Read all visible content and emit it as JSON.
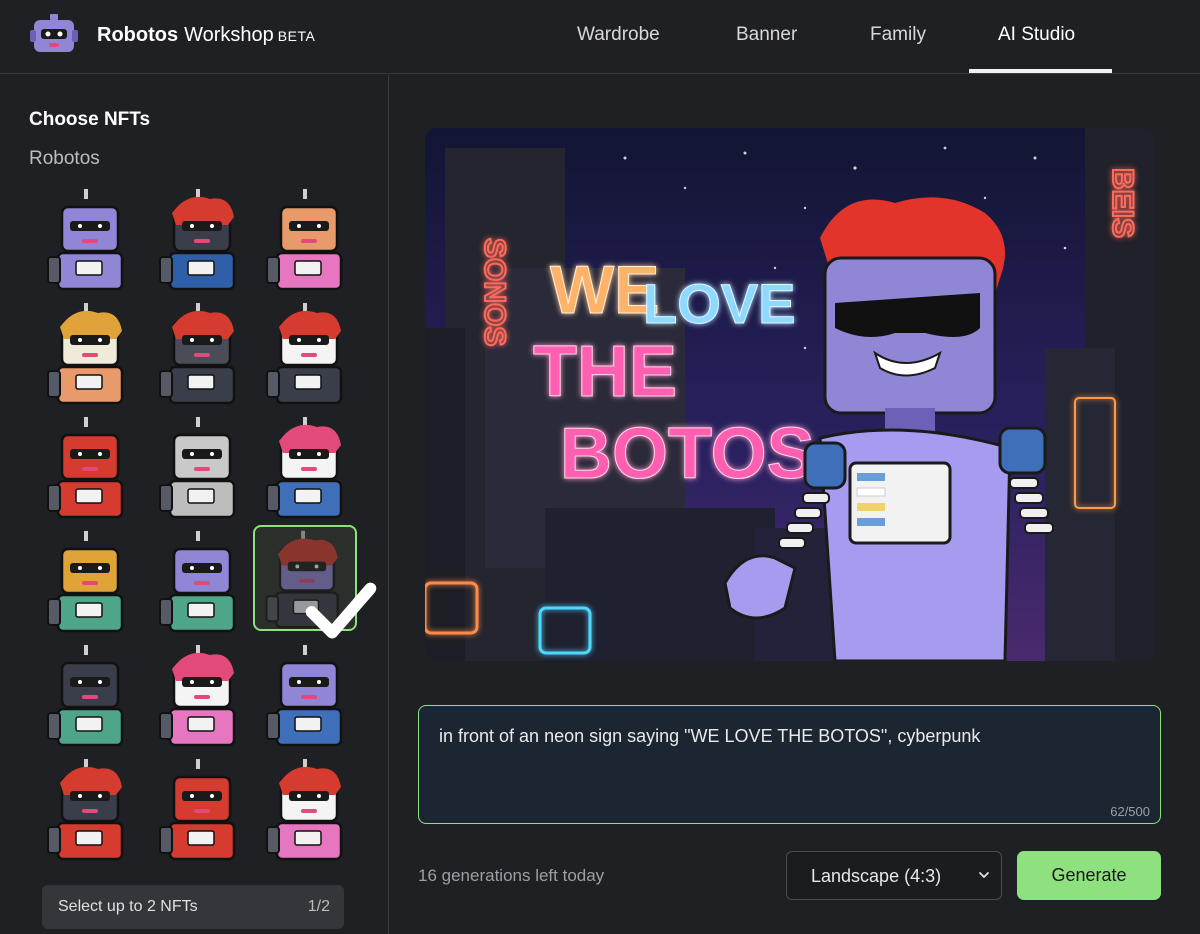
{
  "header": {
    "brand_name": "Robotos",
    "brand_product": "Workshop",
    "brand_tag": "BETA",
    "tabs": [
      {
        "label": "Wardrobe",
        "active": false
      },
      {
        "label": "Banner",
        "active": false
      },
      {
        "label": "Family",
        "active": false
      },
      {
        "label": "AI Studio",
        "active": true
      }
    ]
  },
  "sidebar": {
    "title": "Choose NFTs",
    "collection": "Robotos",
    "nfts": [
      {
        "head": "#8f86d6",
        "body": "#8f86d6",
        "hair": "none",
        "selected": false
      },
      {
        "head": "#3a3d4a",
        "body": "#2f5fa8",
        "hair": "#d63b2f",
        "selected": false
      },
      {
        "head": "#e89a6a",
        "body": "#e776c0",
        "hair": "none",
        "selected": false
      },
      {
        "head": "#f0ead8",
        "body": "#e89a6a",
        "hair": "#e0a33a",
        "selected": false
      },
      {
        "head": "#4a4d57",
        "body": "#3a3d4a",
        "hair": "#d63b2f",
        "selected": false
      },
      {
        "head": "#f4f4f4",
        "body": "#3a3d4a",
        "hair": "#d63b2f",
        "selected": false
      },
      {
        "head": "#d63b2f",
        "body": "#d63b2f",
        "hair": "none",
        "selected": false
      },
      {
        "head": "#c9c9c9",
        "body": "#bdbdbd",
        "hair": "none",
        "selected": false
      },
      {
        "head": "#f4f4f4",
        "body": "#3f6fb8",
        "hair": "#e24a7a",
        "selected": false
      },
      {
        "head": "#e0a33a",
        "body": "#4ea58a",
        "hair": "none",
        "selected": false
      },
      {
        "head": "#8f86d6",
        "body": "#4ea58a",
        "hair": "none",
        "selected": false
      },
      {
        "head": "#8f86d6",
        "body": "#3a3d4a",
        "hair": "#d63b2f",
        "selected": true
      },
      {
        "head": "#3a3d4a",
        "body": "#4ea58a",
        "hair": "none",
        "selected": false
      },
      {
        "head": "#f4f4f4",
        "body": "#e776c0",
        "hair": "#e24a7a",
        "selected": false
      },
      {
        "head": "#8f86d6",
        "body": "#3f6fb8",
        "hair": "none",
        "selected": false
      },
      {
        "head": "#3a3d4a",
        "body": "#d63b2f",
        "hair": "#d63b2f",
        "selected": false
      },
      {
        "head": "#d63b2f",
        "body": "#d63b2f",
        "hair": "none",
        "selected": false
      },
      {
        "head": "#f4f4f4",
        "body": "#e776c0",
        "hair": "#d63b2f",
        "selected": false
      }
    ],
    "footer_text": "Select up to 2 NFTs",
    "footer_count": "1/2"
  },
  "preview": {
    "sign_left": "SONOS",
    "sign_line1a": "WE",
    "sign_line1b": "LOVE",
    "sign_line2": "THE",
    "sign_line3": "BOTOS",
    "sign_right": "BEIS"
  },
  "prompt": {
    "value": "in front of an neon sign saying \"WE LOVE THE BOTOS\", cyberpunk",
    "counter": "62/500"
  },
  "controls": {
    "generations_left": "16 generations left today",
    "aspect_selected": "Landscape (4:3)",
    "generate_label": "Generate"
  },
  "colors": {
    "accent": "#8fe07f",
    "background": "#1f2023",
    "neon_pink": "#ff5fb0",
    "neon_blue": "#8fd8ff",
    "neon_orange": "#ffb36b"
  }
}
